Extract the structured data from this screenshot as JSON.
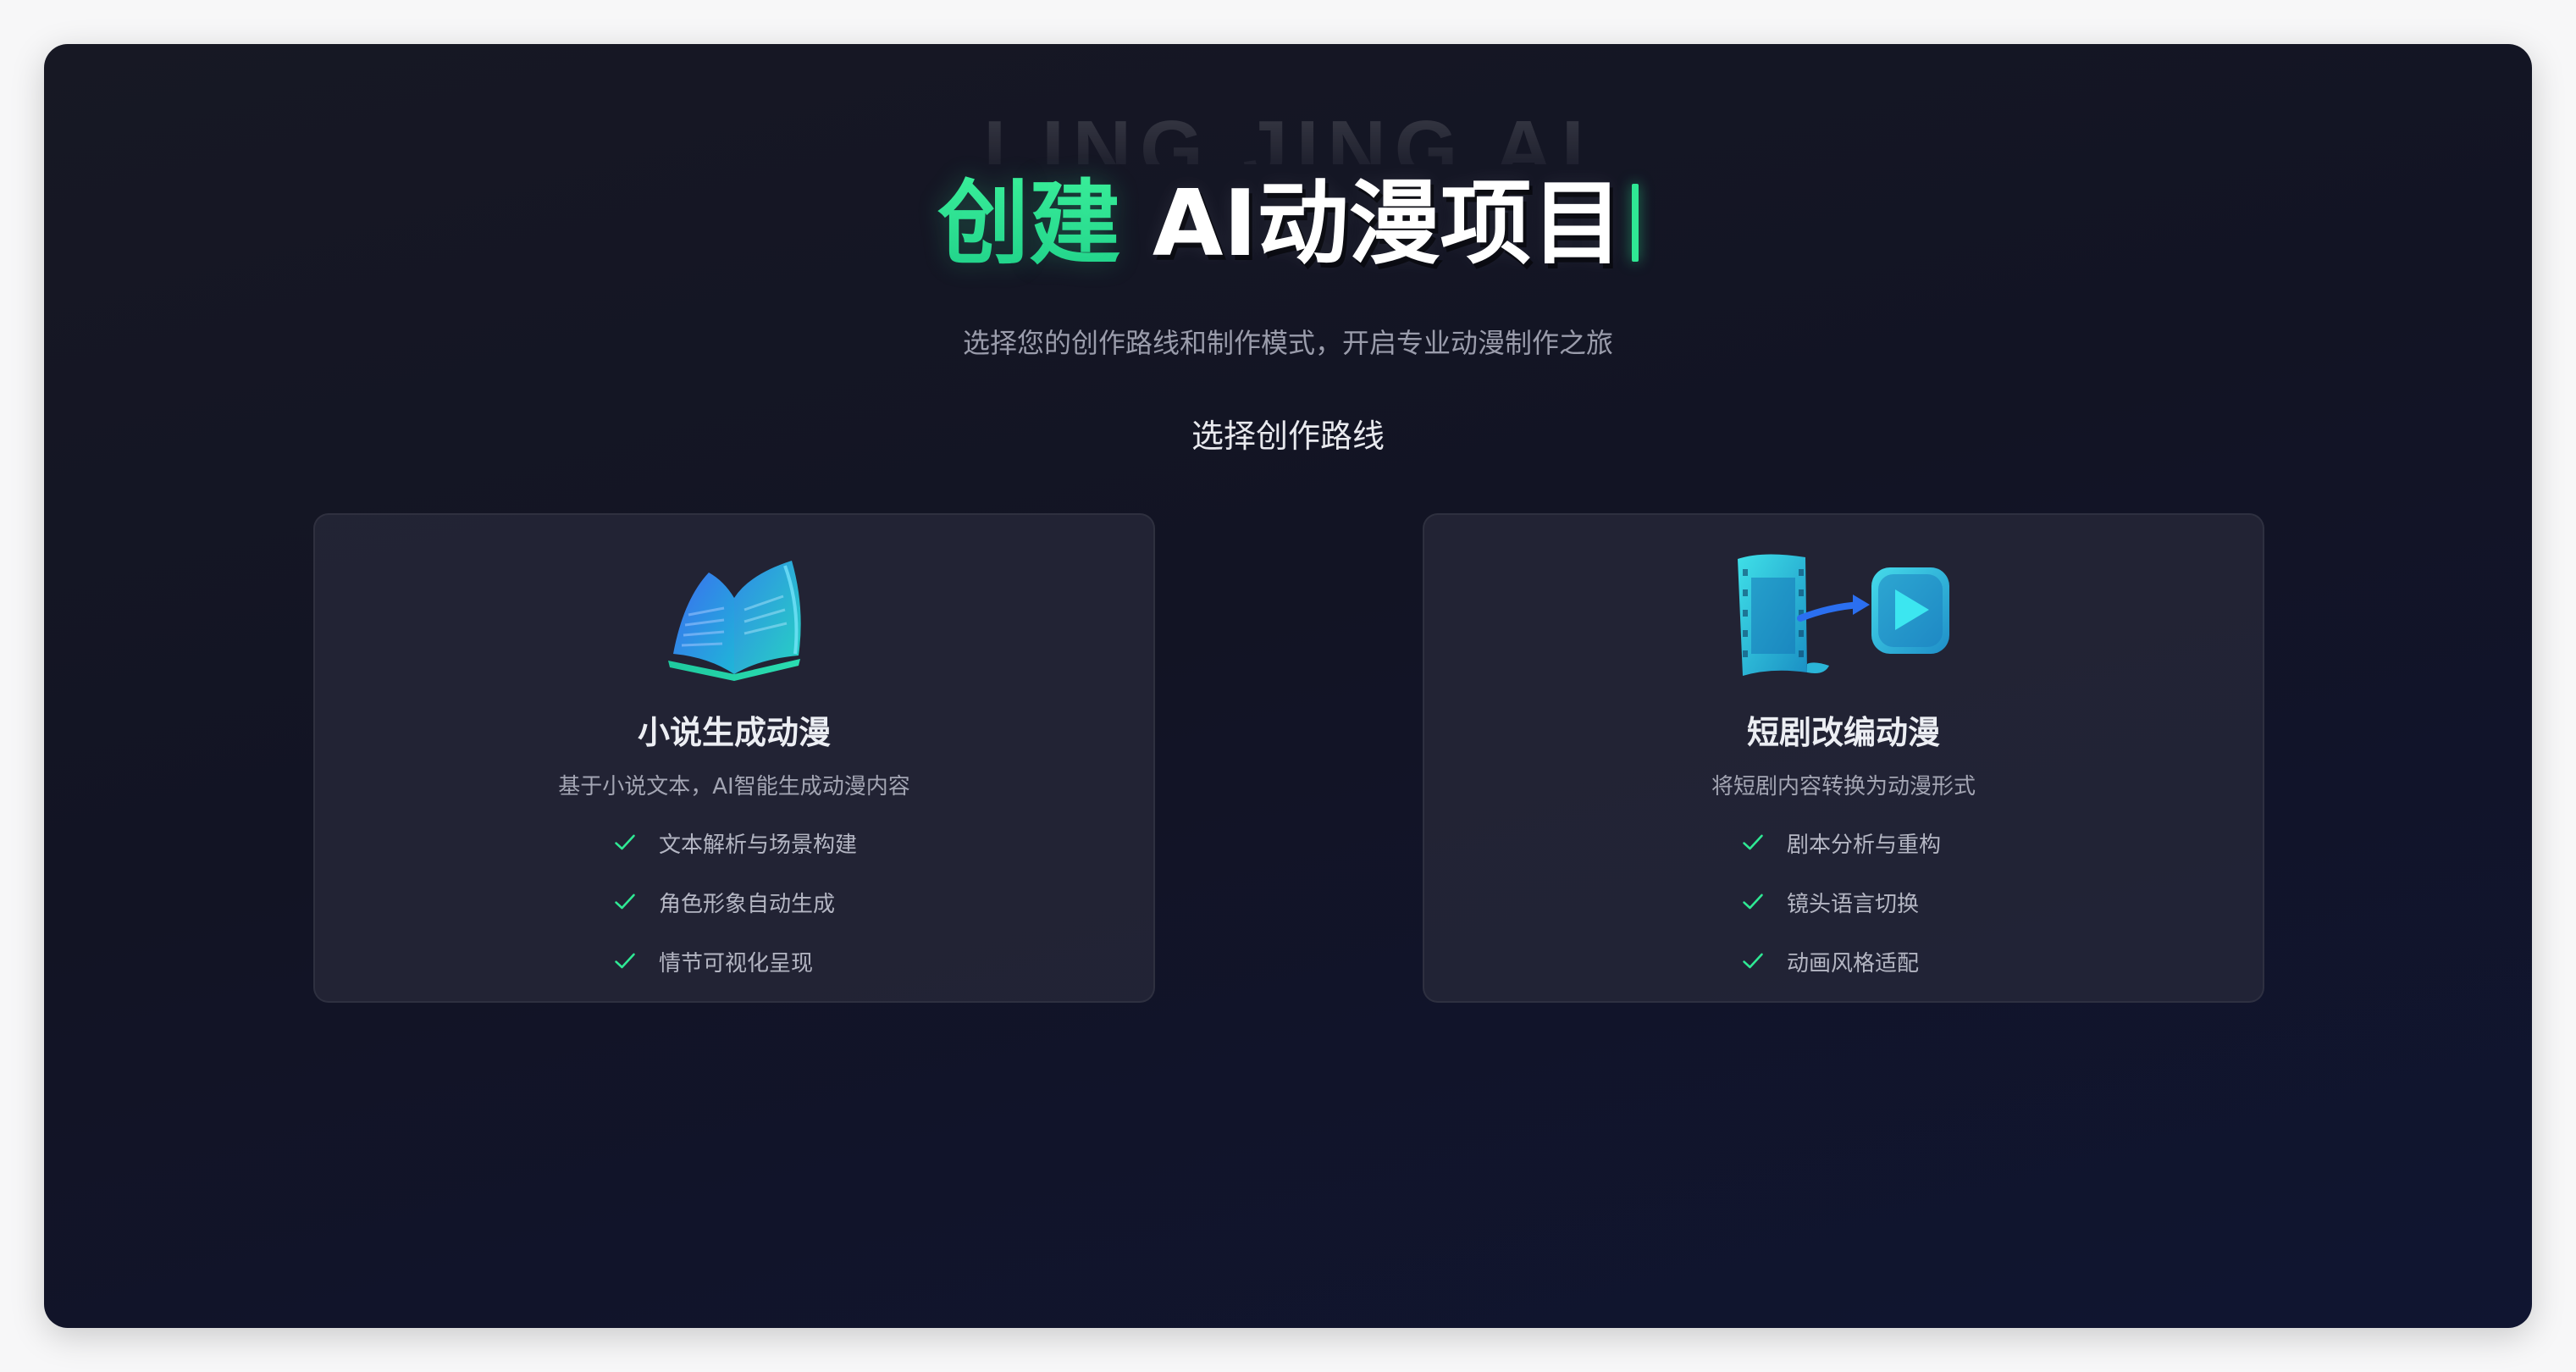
{
  "watermark": "LING JING AI",
  "hero": {
    "title_accent": "创建 ",
    "title_main": "AI动漫项目"
  },
  "subtitle": "选择您的创作路线和制作模式，开启专业动漫制作之旅",
  "section_label": "选择创作路线",
  "colors": {
    "accent": "#2fe894",
    "background": "#131526",
    "card": "#282a3a"
  },
  "routes": [
    {
      "icon": "open-book-icon",
      "title": "小说生成动漫",
      "description": "基于小说文本，AI智能生成动漫内容",
      "features": [
        "文本解析与场景构建",
        "角色形象自动生成",
        "情节可视化呈现"
      ]
    },
    {
      "icon": "film-to-play-icon",
      "title": "短剧改编动漫",
      "description": "将短剧内容转换为动漫形式",
      "features": [
        "剧本分析与重构",
        "镜头语言切换",
        "动画风格适配"
      ]
    }
  ]
}
